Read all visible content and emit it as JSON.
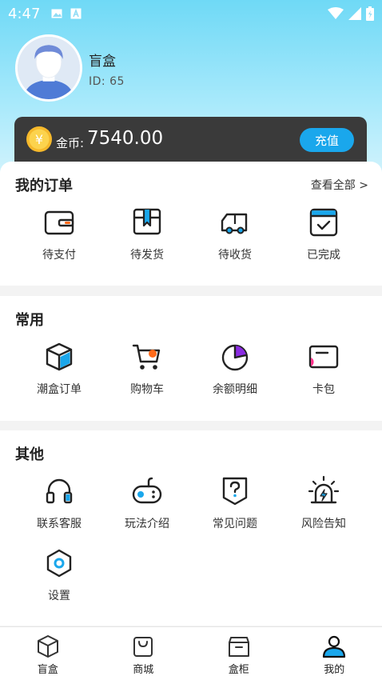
{
  "status_bar": {
    "time": "4:47"
  },
  "profile": {
    "name": "盲盒",
    "id_text": "ID: 65"
  },
  "wallet": {
    "coin_label": "金币:",
    "coin_value": "7540.00",
    "recharge_label": "充值",
    "coin_symbol": "¥"
  },
  "orders": {
    "title": "我的订单",
    "view_all": "查看全部 >",
    "items": [
      {
        "label": "待支付",
        "icon": "wallet-icon"
      },
      {
        "label": "待发货",
        "icon": "box-icon"
      },
      {
        "label": "待收货",
        "icon": "truck-icon"
      },
      {
        "label": "已完成",
        "icon": "check-icon"
      }
    ]
  },
  "common": {
    "title": "常用",
    "items": [
      {
        "label": "潮盒订单",
        "icon": "cube-icon"
      },
      {
        "label": "购物车",
        "icon": "cart-icon"
      },
      {
        "label": "余额明细",
        "icon": "pie-chart-icon"
      },
      {
        "label": "卡包",
        "icon": "card-icon"
      }
    ]
  },
  "other": {
    "title": "其他",
    "items": [
      {
        "label": "联系客服",
        "icon": "headset-icon"
      },
      {
        "label": "玩法介绍",
        "icon": "gamepad-icon"
      },
      {
        "label": "常见问题",
        "icon": "help-icon"
      },
      {
        "label": "风险告知",
        "icon": "alarm-icon"
      },
      {
        "label": "设置",
        "icon": "settings-icon"
      }
    ]
  },
  "tabs": [
    {
      "label": "盲盒",
      "icon": "cube-tab-icon"
    },
    {
      "label": "商城",
      "icon": "bag-tab-icon"
    },
    {
      "label": "盒柜",
      "icon": "cabinet-tab-icon"
    },
    {
      "label": "我的",
      "icon": "user-tab-icon"
    }
  ],
  "colors": {
    "accent": "#1aa7ec",
    "header_top": "#6fd9f6",
    "wallet_bg": "#3a3a3a",
    "highlight_orange": "#ff6a1a",
    "highlight_purple": "#8a2be2",
    "highlight_pink": "#ff2d8a"
  }
}
